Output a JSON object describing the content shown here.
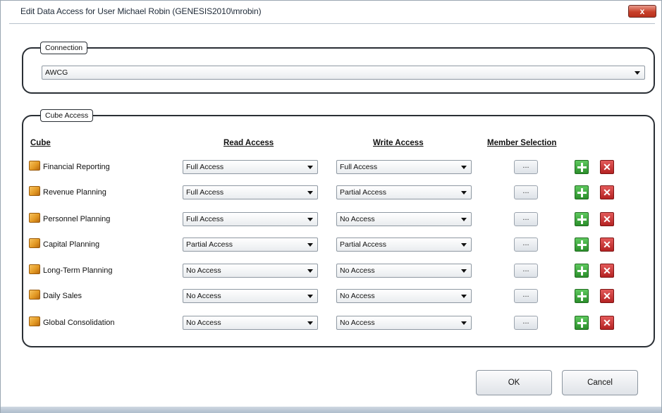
{
  "window": {
    "title": "Edit Data Access for User Michael Robin (GENESIS2010\\mrobin)",
    "close_label": "x"
  },
  "connection": {
    "legend": "Connection",
    "value": "AWCG"
  },
  "cube_access": {
    "legend": "Cube Access",
    "headers": {
      "cube": "Cube",
      "read": "Read Access",
      "write": "Write Access",
      "member": "Member Selection"
    },
    "ellipsis_label": "...",
    "delete_label": "✕",
    "rows": [
      {
        "cube": "Financial Reporting",
        "read": "Full Access",
        "write": "Full Access"
      },
      {
        "cube": "Revenue Planning",
        "read": "Full Access",
        "write": "Partial Access"
      },
      {
        "cube": "Personnel Planning",
        "read": "Full Access",
        "write": "No Access"
      },
      {
        "cube": "Capital Planning",
        "read": "Partial Access",
        "write": "Partial Access"
      },
      {
        "cube": "Long-Term Planning",
        "read": "No Access",
        "write": "No Access"
      },
      {
        "cube": "Daily Sales",
        "read": "No Access",
        "write": "No Access"
      },
      {
        "cube": "Global Consolidation",
        "read": "No Access",
        "write": "No Access"
      }
    ]
  },
  "buttons": {
    "ok": "OK",
    "cancel": "Cancel"
  }
}
